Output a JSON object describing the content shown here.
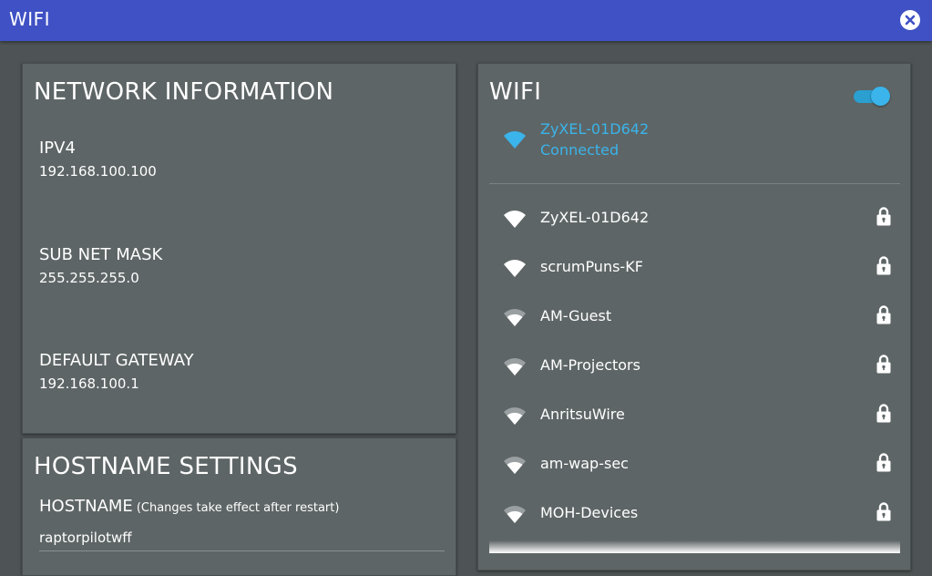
{
  "window": {
    "title": "WIFI"
  },
  "network_info": {
    "heading": "NETWORK INFORMATION",
    "ipv4_label": "IPV4",
    "ipv4_value": "192.168.100.100",
    "subnet_label": "SUB NET MASK",
    "subnet_value": "255.255.255.0",
    "gateway_label": "DEFAULT GATEWAY",
    "gateway_value": "192.168.100.1"
  },
  "hostname_settings": {
    "heading": "HOSTNAME SETTINGS",
    "label": "HOSTNAME",
    "hint": "(Changes take effect after restart)",
    "value": "raptorpilotwff"
  },
  "wifi": {
    "heading": "WIFI",
    "enabled": true,
    "connected": {
      "name": "ZyXEL-01D642",
      "status": "Connected"
    },
    "networks": [
      {
        "name": "ZyXEL-01D642",
        "signal": 3,
        "locked": true
      },
      {
        "name": "scrumPuns-KF",
        "signal": 3,
        "locked": true
      },
      {
        "name": "AM-Guest",
        "signal": 2,
        "locked": true
      },
      {
        "name": "AM-Projectors",
        "signal": 2,
        "locked": true
      },
      {
        "name": "AnritsuWire",
        "signal": 2,
        "locked": true
      },
      {
        "name": "am-wap-sec",
        "signal": 2,
        "locked": true
      },
      {
        "name": "MOH-Devices",
        "signal": 2,
        "locked": true
      }
    ]
  },
  "colors": {
    "titlebar": "#3f51c4",
    "accent": "#3ab4ea",
    "panel": "#5e6566",
    "background": "#4e5455"
  }
}
